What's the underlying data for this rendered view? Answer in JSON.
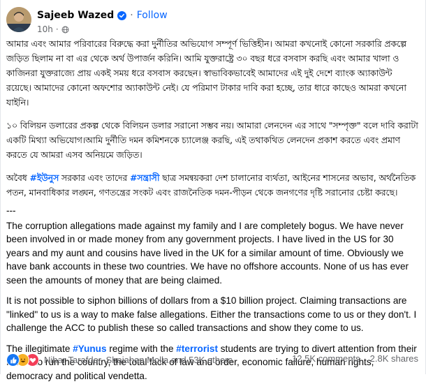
{
  "post": {
    "author": "Sajeeb Wazed",
    "dot": "·",
    "follow_label": "Follow",
    "time": "10h",
    "meta_dot": "·",
    "paragraphs_bn": [
      "আমার এবং আমার পরিবারের বিরুদ্ধে করা দুর্নীতির অভিযোগ সম্পূর্ণ ভিত্তিহীন। আমরা কখনোই কোনো সরকারি প্রকল্পে জড়িত ছিলাম না বা এর থেকে অর্থ উপার্জন করিনি। আমি যুক্তরাষ্ট্রে ৩০ বছর ধরে বসবাস করছি এবং আমার খালা ও কাজিনরা যুক্তরাজ্যে প্রায় একই সময় ধরে বসবাস করছেন। স্বাভাবিকভাবেই আমাদের এই দুই দেশে ব্যাংক অ্যাকাউন্ট রয়েছে। আমাদের কোনো অফশোর অ্যাকাউন্ট নেই। যে পরিমাণ টাকার দাবি করা হচ্ছে, তার ধারে কাছেও আমরা কখনো যাইনি।",
      "১০ বিলিয়ন ডলারের প্রকল্প থেকে বিলিয়ন ডলার সরানো সম্ভব নয়। আমারা লেনদেন এর সাথে \"সম্পৃক্ত\" বলে দাবি করাটা একটি মিথ্যা অভিযোগ।আমি দুর্নীতি দমন কমিশনকে চ্যালেঞ্জ করছি, এই তথাকথিত লেনদেন প্রকাশ করতে এবং প্রমাণ করতে যে আমরা এসব অনিয়মে জড়িত।"
    ],
    "bn_p3": {
      "t1": "অবৈধ ",
      "tag1": "#ইউনুস",
      "t2": " সরকার এবং তাদের ",
      "tag2": "#সন্ত্রাসী",
      "t3": " ছাত্র সমন্বয়করা দেশ চালানোর ব্যর্থতা, আইনের শাসনের অভাব, অর্থনৈতিক পতন, মানবাধিকার লঙ্ঘন, গণতন্ত্রের সংকট এবং রাজনৈতিক দমন-পীড়ন থেকে জনগণের দৃষ্টি সরানোর চেষ্টা করছে।"
    },
    "separator": "---",
    "paragraphs_en": [
      "The corruption allegations made against my family and I are completely bogus. We have never been involved in or made money from any government projects. I have lived in the US for 30 years and my aunt and cousins have lived in the UK for a similar amount of time. Obviously we have bank accounts in these two countries. We have no offshore accounts. None of us has ever seen the amounts of money that are being claimed.",
      "It is not possible to siphon billions of dollars from a $10 billion project. Claiming transactions are \"linked\" to us is a way to make false allegations. Either the transactions come to us or they don't. I challenge the ACC to publish these so called transactions and show they come to us."
    ],
    "en_p3": {
      "t1": "The illegitimate ",
      "tag1": "#Yunus",
      "t2": " regime with the ",
      "tag2": "#terrorist",
      "t3": " students are trying to divert attention from their failure to run the country, the total lack of law and order, economic failure, human rights, democracy and political vendetta."
    }
  },
  "footer": {
    "reactors": "Nihar Tarafder, Shajahan Molla and 53K others",
    "comments": "12.5K comments",
    "shares": "2.8K shares"
  },
  "icons": [
    "avatar",
    "verified-badge-icon",
    "globe-icon",
    "like-reaction-icon",
    "haha-reaction-icon",
    "love-reaction-icon"
  ],
  "colors": {
    "link": "#0866ff",
    "muted": "#65676b",
    "verified": "#0866ff",
    "like": "#1877f2",
    "love": "#f33e58",
    "haha": "#f7b125"
  }
}
